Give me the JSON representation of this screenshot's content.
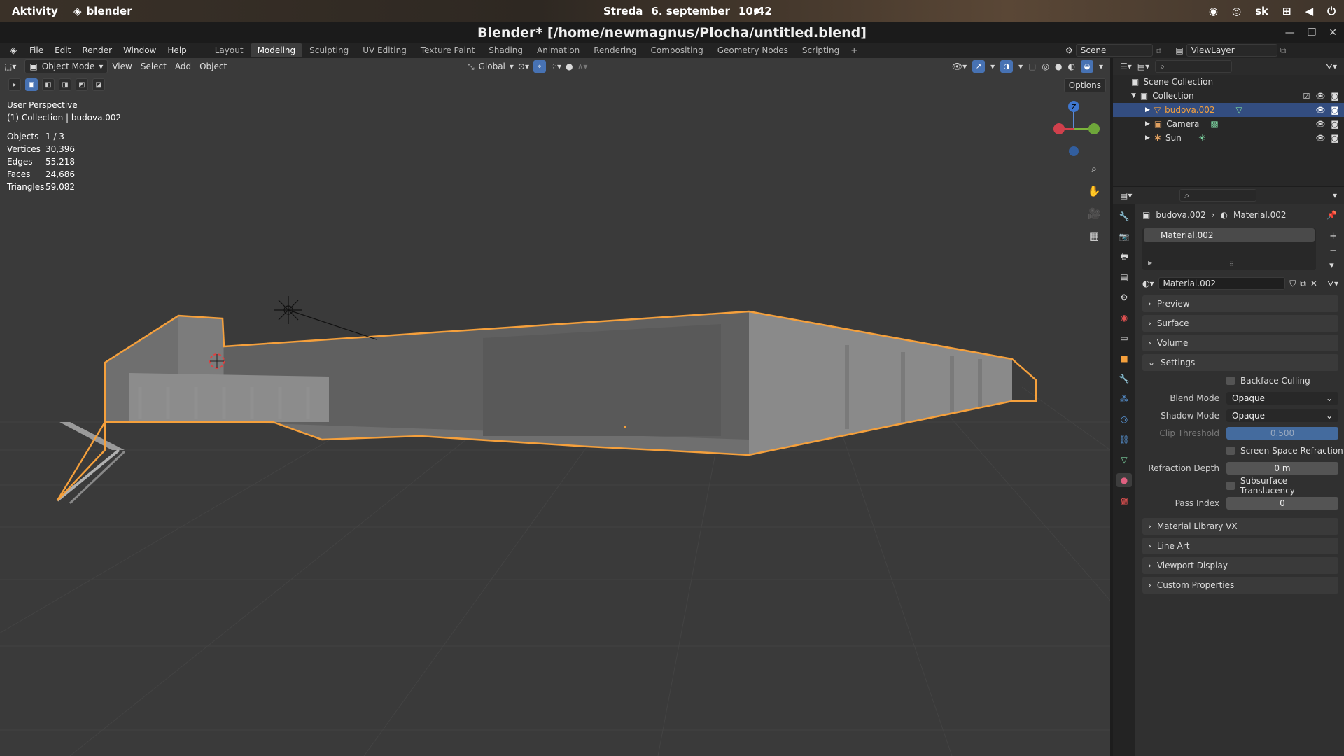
{
  "gnome": {
    "activities": "Aktivity",
    "app": "blender",
    "day": "Streda",
    "date": "6. september",
    "time": "10:42",
    "lang": "sk"
  },
  "window": {
    "title": "Blender* [/home/newmagnus/Plocha/untitled.blend]"
  },
  "menus": [
    "File",
    "Edit",
    "Render",
    "Window",
    "Help"
  ],
  "workspaces": [
    "Layout",
    "Modeling",
    "Sculpting",
    "UV Editing",
    "Texture Paint",
    "Shading",
    "Animation",
    "Rendering",
    "Compositing",
    "Geometry Nodes",
    "Scripting"
  ],
  "active_workspace": "Modeling",
  "scene": {
    "scene_name": "Scene",
    "view_layer": "ViewLayer"
  },
  "viewport": {
    "mode": "Object Mode",
    "menus": [
      "View",
      "Select",
      "Add",
      "Object"
    ],
    "transform": "Global",
    "options": "Options",
    "perspective": "User Perspective",
    "context": "(1) Collection | budova.002",
    "stats": [
      {
        "k": "Objects",
        "v": "1 / 3"
      },
      {
        "k": "Vertices",
        "v": "30,396"
      },
      {
        "k": "Edges",
        "v": "55,218"
      },
      {
        "k": "Faces",
        "v": "24,686"
      },
      {
        "k": "Triangles",
        "v": "59,082"
      }
    ],
    "gizmo_axis": "Z"
  },
  "outliner": {
    "root": "Scene Collection",
    "collection": "Collection",
    "items": [
      {
        "name": "budova.002",
        "selected": true
      },
      {
        "name": "Camera",
        "selected": false
      },
      {
        "name": "Sun",
        "selected": false
      }
    ]
  },
  "properties": {
    "object": "budova.002",
    "material": "Material.002",
    "slot": "Material.002",
    "datablock": "Material.002",
    "panels_top": [
      "Preview",
      "Surface",
      "Volume"
    ],
    "settings": {
      "title": "Settings",
      "backface_culling": "Backface Culling",
      "blend_mode_label": "Blend Mode",
      "blend_mode": "Opaque",
      "shadow_mode_label": "Shadow Mode",
      "shadow_mode": "Opaque",
      "clip_label": "Clip Threshold",
      "clip": "0.500",
      "ssr": "Screen Space Refraction",
      "refraction_label": "Refraction Depth",
      "refraction": "0 m",
      "subsurface": "Subsurface Translucency",
      "pass_label": "Pass Index",
      "pass": "0"
    },
    "panels_bottom": [
      "Material Library VX",
      "Line Art",
      "Viewport Display",
      "Custom Properties"
    ]
  },
  "colors": {
    "accent": "#4772b3",
    "selection_outline": "#f5a03c",
    "viewport_bg": "#3a3a3a"
  }
}
